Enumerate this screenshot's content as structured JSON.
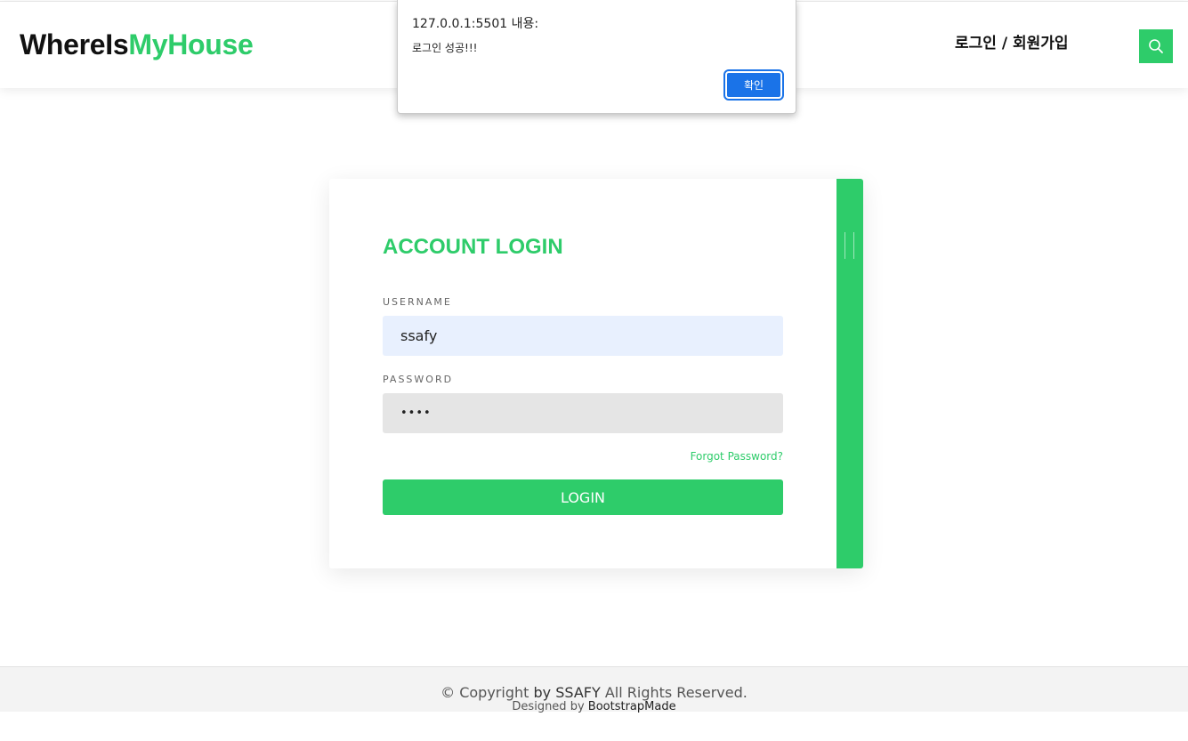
{
  "header": {
    "logo_part1": "WhereIs",
    "logo_part2": "MyHouse",
    "auth_link": "로그인 / 회원가입",
    "search_icon": "search-icon"
  },
  "alert": {
    "origin": "127.0.0.1:5501 내용:",
    "message": "로그인 성공!!!",
    "ok_label": "확인"
  },
  "login": {
    "title": "ACCOUNT LOGIN",
    "username_label": "USERNAME",
    "username_value": "ssafy",
    "password_label": "PASSWORD",
    "password_value": "••••",
    "forgot_label": "Forgot Password?",
    "submit_label": "LOGIN"
  },
  "footer": {
    "copyright_prefix": "© Copyright",
    "by": "by",
    "owner": "SSAFY",
    "rights": "All Rights Reserved.",
    "designed_by": "Designed by",
    "designer": "BootstrapMade"
  },
  "colors": {
    "accent": "#2ecc6a",
    "alert_button": "#1a73e8",
    "username_field_bg": "#e8f0fe",
    "password_field_bg": "#e5e5e5"
  }
}
